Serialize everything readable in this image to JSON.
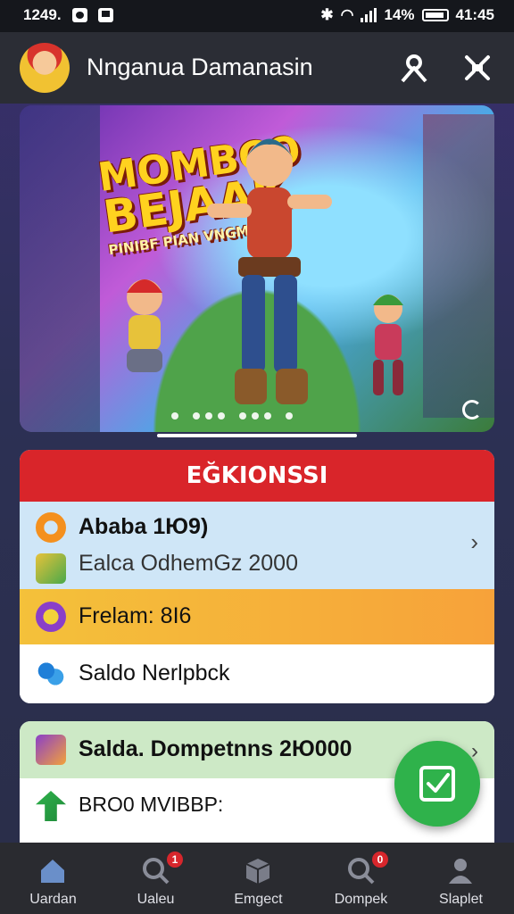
{
  "status_bar": {
    "time_left": "1249.",
    "battery_percent": "14%",
    "time_right": "41:45"
  },
  "app_bar": {
    "title": "Nnganua Damanasin",
    "avatar_icon": "avatar-icon",
    "actions": [
      "user-icon",
      "expand-icon"
    ]
  },
  "banner": {
    "logo_line1": "MOMBCO",
    "logo_line2": "BEJAAK",
    "logo_line3": "PINIBF PIAN VNGMIANI",
    "carousel_pages": 7,
    "active_page": 1
  },
  "card1": {
    "header": "EĞKIONSSI",
    "row1_title": "Ababa  1Ю9)",
    "row1_subtitle": "Ealca OdhemGz 2000",
    "row2_label": "Frelam: 8I6",
    "row3_label": "Saldo Nerlpbck"
  },
  "card2": {
    "row1_label": "Salda. Dompetnns 2Ю000",
    "row2_label": "BRO0 MVIBBP:"
  },
  "fab": {
    "icon": "checkbox-icon"
  },
  "bottom_nav": {
    "items": [
      {
        "label": "Uardan",
        "icon": "home-icon",
        "badge": ""
      },
      {
        "label": "Ualeu",
        "icon": "search-icon",
        "badge": "1"
      },
      {
        "label": "Emgect",
        "icon": "box-icon",
        "badge": ""
      },
      {
        "label": "Dompek",
        "icon": "search-icon",
        "badge": "0"
      },
      {
        "label": "Slaplet",
        "icon": "profile-icon",
        "badge": ""
      }
    ]
  },
  "colors": {
    "header_red": "#d9252a",
    "row_blue": "#cfe6f7",
    "row_orange": "#f7a23a",
    "row_green": "#cde9c6",
    "fab_green": "#2fb24b"
  }
}
